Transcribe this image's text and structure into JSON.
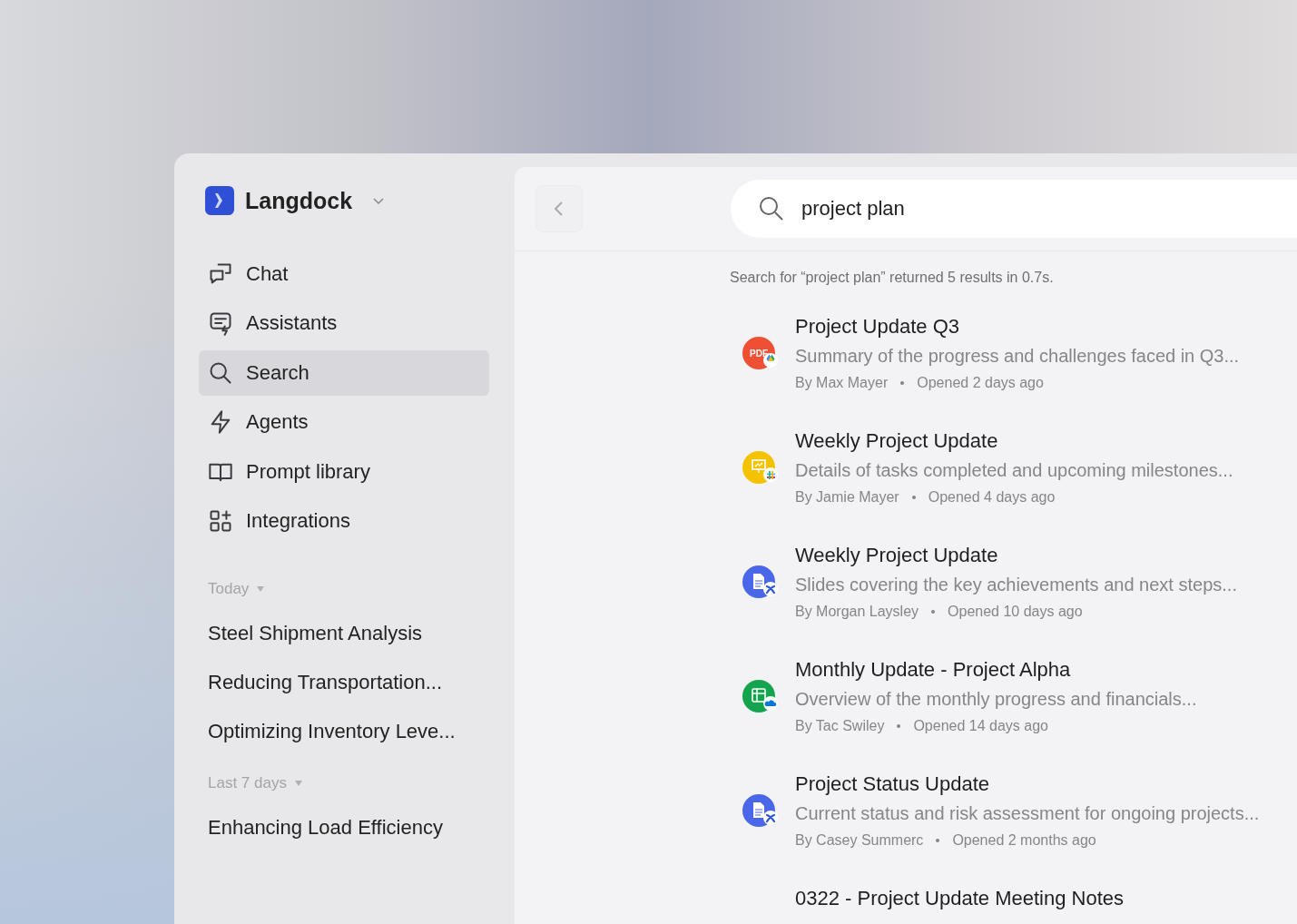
{
  "workspace": {
    "name": "Langdock"
  },
  "nav": [
    {
      "label": "Chat",
      "selected": false
    },
    {
      "label": "Assistants",
      "selected": false
    },
    {
      "label": "Search",
      "selected": true
    },
    {
      "label": "Agents",
      "selected": false
    },
    {
      "label": "Prompt library",
      "selected": false
    },
    {
      "label": "Integrations",
      "selected": false
    }
  ],
  "history": [
    {
      "heading": "Today",
      "expanded": true,
      "items": [
        "Steel Shipment Analysis",
        "Reducing Transportation...",
        "Optimizing Inventory Leve..."
      ]
    },
    {
      "heading": "Last 7 days",
      "expanded": true,
      "items": [
        "Enhancing Load Efficiency"
      ]
    }
  ],
  "search": {
    "value": "project plan",
    "summary": "Search for “project plan” returned 5 results in 0.7s."
  },
  "results": [
    {
      "title": "Project Update Q3",
      "description": "Summary of the progress and challenges faced in Q3...",
      "author": "By Max Mayer",
      "opened": "Opened 2 days ago",
      "kind": "pdf",
      "icon_label": "PDF",
      "badge": {
        "kind": "drive"
      }
    },
    {
      "title": "Weekly Project Update",
      "description": "Details of tasks completed and upcoming milestones...",
      "author": "By Jamie Mayer",
      "opened": "Opened 4 days ago",
      "kind": "slides",
      "badge": {
        "kind": "slack"
      }
    },
    {
      "title": "Weekly Project Update",
      "description": "Slides covering the key achievements and next steps...",
      "author": "By Morgan Laysley",
      "opened": "Opened 10 days ago",
      "kind": "doc",
      "badge": {
        "kind": "confluence"
      }
    },
    {
      "title": "Monthly Update - Project Alpha",
      "description": "Overview of the monthly progress and financials...",
      "author": "By Tac Swiley",
      "opened": "Opened 14 days ago",
      "kind": "sheet",
      "badge": {
        "kind": "onedrive"
      }
    },
    {
      "title": "Project Status Update",
      "description": "Current status and risk assessment for ongoing projects...",
      "author": "By Casey Summerc",
      "opened": "Opened 2 months ago",
      "kind": "doc",
      "badge": {
        "kind": "confluence"
      }
    },
    {
      "title": "0322 - Project Update Meeting Notes"
    }
  ]
}
